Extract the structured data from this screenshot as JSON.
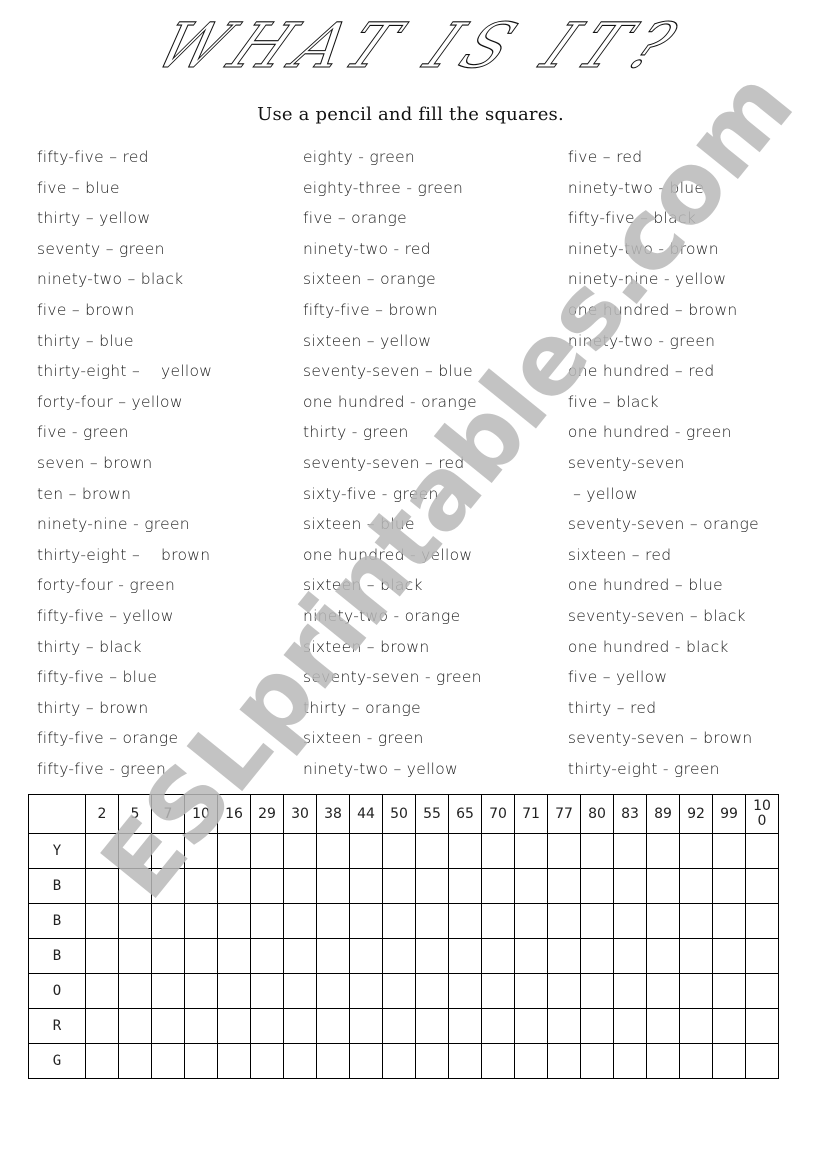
{
  "worksheet": {
    "title": "WHAT IS IT?",
    "instructions": "Use  a pencil and fill the squares.",
    "watermark": "ESLprintables.com",
    "watermark_color": "#b8b8b8"
  },
  "clues": {
    "column_1": [
      "fifty-five – red",
      "five – blue",
      "thirty – yellow",
      "seventy – green",
      "ninety-two – black",
      "five – brown",
      "thirty – blue",
      "thirty-eight –    yellow",
      "forty-four – yellow",
      "five - green",
      "seven – brown",
      "ten – brown",
      "ninety-nine - green",
      "thirty-eight –    brown",
      "forty-four - green",
      "fifty-five – yellow",
      "thirty – black",
      "fifty-five – blue",
      "thirty – brown",
      "fifty-five – orange",
      "fifty-five - green"
    ],
    "column_2": [
      "eighty - green",
      "eighty-three - green",
      "five – orange",
      "ninety-two - red",
      "sixteen – orange",
      "fifty-five – brown",
      "sixteen – yellow",
      "seventy-seven – blue",
      "one hundred - orange",
      "thirty - green",
      "seventy-seven – red",
      "sixty-five - green",
      "sixteen – blue",
      "one hundred - yellow",
      "sixteen – black",
      "ninety-two - orange",
      "sixteen – brown",
      "seventy-seven - green",
      "thirty – orange",
      "sixteen - green",
      "ninety-two – yellow"
    ],
    "column_3": [
      "five – red",
      "ninety-two - blue",
      "fifty-five – black",
      "ninety-two - brown",
      "ninety-nine - yellow",
      "one hundred – brown",
      "ninety-two - green",
      "one hundred – red",
      "five – black",
      "one hundred - green",
      "seventy-seven",
      " – yellow",
      "seventy-seven – orange",
      "sixteen – red",
      "one hundred – blue",
      "seventy-seven – black",
      "one hundred - black",
      "five – yellow",
      "thirty – red",
      "seventy-seven – brown",
      "thirty-eight - green"
    ]
  },
  "grid": {
    "column_headers": [
      "2",
      "5",
      "7",
      "10",
      "16",
      "29",
      "30",
      "38",
      "44",
      "50",
      "55",
      "65",
      "70",
      "71",
      "77",
      "80",
      "83",
      "89",
      "92",
      "99",
      "10\n0"
    ],
    "row_labels": [
      "Y",
      "B",
      "B",
      "B",
      "O",
      "R",
      "G"
    ]
  }
}
